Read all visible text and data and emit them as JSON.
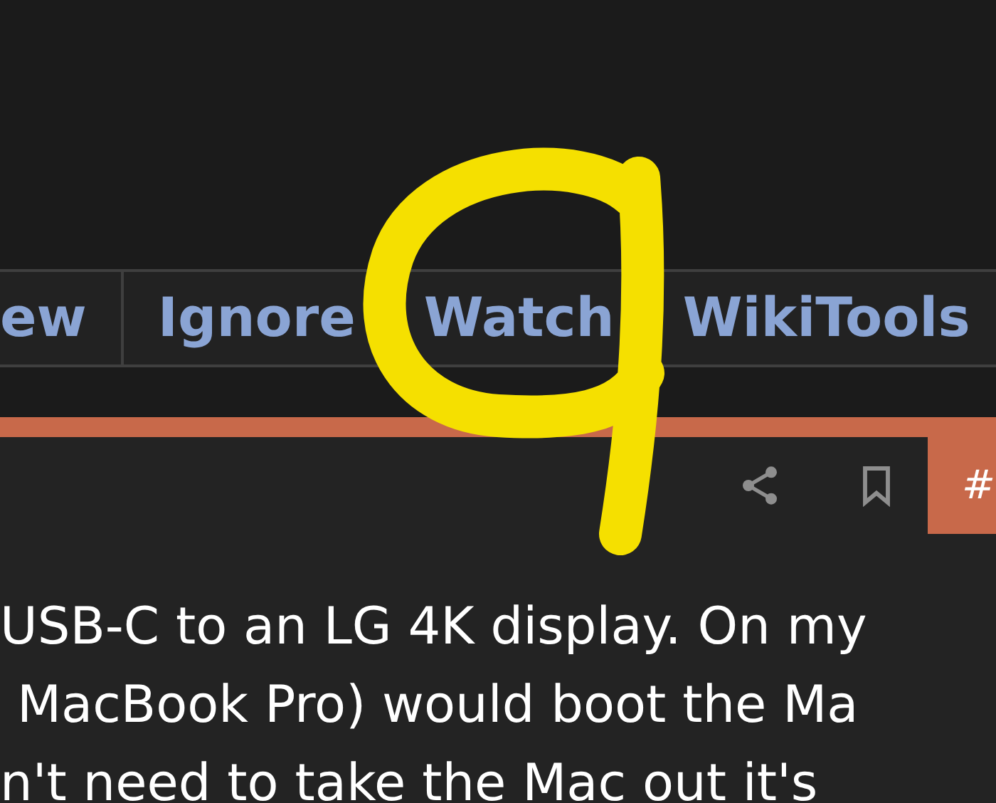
{
  "tabs": [
    {
      "label": "ew"
    },
    {
      "label": "Ignore"
    },
    {
      "label": "Watch"
    },
    {
      "label": "WikiTools"
    }
  ],
  "post": {
    "permalink": "#",
    "lines": [
      "USB-C to an LG 4K display. On my",
      "MacBook Pro) would boot the Ma",
      "n't need to take the Mac out it's"
    ]
  }
}
